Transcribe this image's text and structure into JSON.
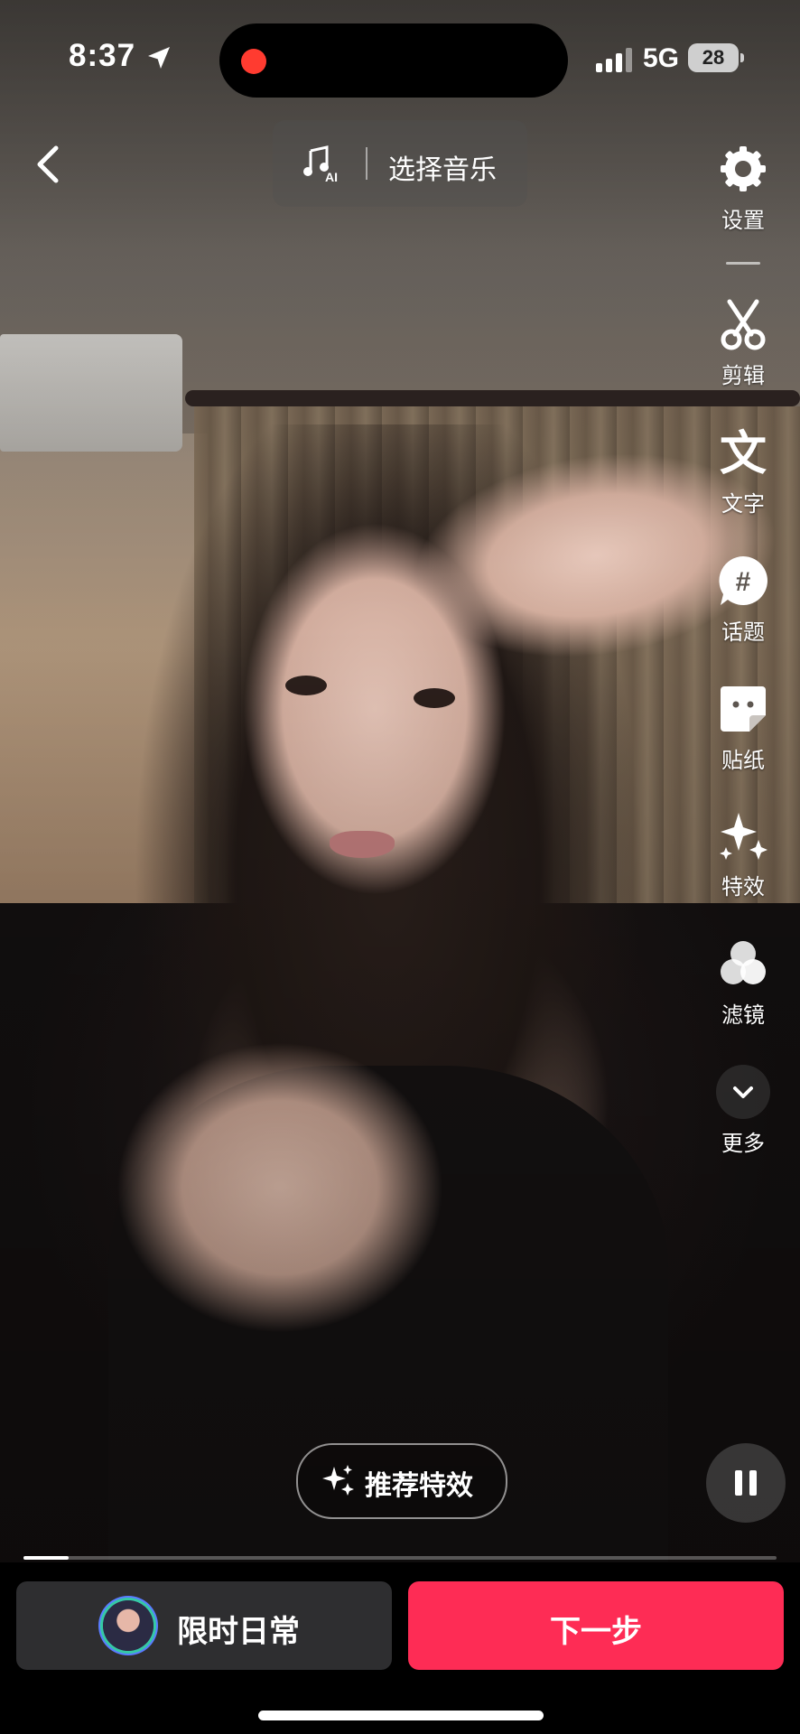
{
  "status_bar": {
    "time": "8:37",
    "network": "5G",
    "battery": "28",
    "recording_color": "#ff3b30"
  },
  "top": {
    "back_icon": "chevron-left-icon",
    "music_icon": "music-ai-icon",
    "music_label": "选择音乐"
  },
  "toolbar": {
    "items": [
      {
        "id": "settings",
        "label": "设置",
        "icon": "gear-icon"
      },
      {
        "id": "edit",
        "label": "剪辑",
        "icon": "scissors-icon"
      },
      {
        "id": "text",
        "label": "文字",
        "icon": "text-icon"
      },
      {
        "id": "topic",
        "label": "话题",
        "icon": "hashtag-icon"
      },
      {
        "id": "sticker",
        "label": "贴纸",
        "icon": "sticker-icon"
      },
      {
        "id": "effects",
        "label": "特效",
        "icon": "sparkle-icon"
      },
      {
        "id": "filter",
        "label": "滤镜",
        "icon": "filter-icon"
      },
      {
        "id": "more",
        "label": "更多",
        "icon": "chevron-down-icon"
      }
    ]
  },
  "player": {
    "recommend_effects_label": "推荐特效",
    "pause_icon": "pause-icon",
    "progress_fraction": 0.06
  },
  "bottom": {
    "daily_label": "限时日常",
    "next_label": "下一步",
    "next_color": "#fe2c55"
  }
}
